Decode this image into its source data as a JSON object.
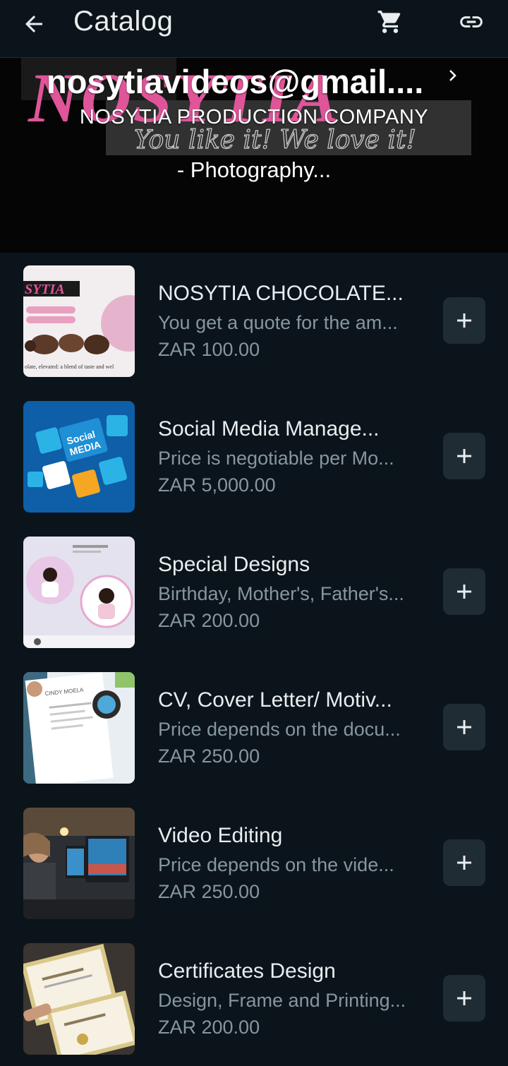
{
  "appbar": {
    "title": "Catalog",
    "icons": {
      "back": "arrow-left-icon",
      "cart": "cart-icon",
      "link": "link-icon"
    }
  },
  "banner": {
    "email": "nosytiavideos@gmail....",
    "company": "NOSYTIA PRODUCTION COMPANY",
    "description": "- Photography...",
    "logo_text": "NOSYTIA",
    "logo_tagline": "You like it! We love it!"
  },
  "products": [
    {
      "name": "NOSYTIA CHOCOLATE...",
      "description": "You get a quote for the am...",
      "price": "ZAR 100.00"
    },
    {
      "name": "Social Media Manage...",
      "description": "Price is negotiable per Mo...",
      "price": "ZAR 5,000.00"
    },
    {
      "name": "Special Designs",
      "description": "Birthday, Mother's, Father's...",
      "price": "ZAR 200.00"
    },
    {
      "name": "CV, Cover Letter/ Motiv...",
      "description": "Price depends on the docu...",
      "price": "ZAR 250.00"
    },
    {
      "name": "Video Editing",
      "description": "Price depends on the vide...",
      "price": "ZAR 250.00"
    },
    {
      "name": "Certificates Design",
      "description": "Design, Frame and Printing...",
      "price": "ZAR 200.00"
    }
  ],
  "thumb_text": {
    "chocolate_caption": "olate, elevated: a blend of taste and wel",
    "social_word1": "Social",
    "social_word2": "MEDIA",
    "cv_name": "CINDY MOELA"
  },
  "colors": {
    "background": "#0b141a",
    "surface": "#1f2c34",
    "text_primary": "#e9edef",
    "text_secondary": "#8696a0",
    "logo_pink": "#e0559a"
  }
}
